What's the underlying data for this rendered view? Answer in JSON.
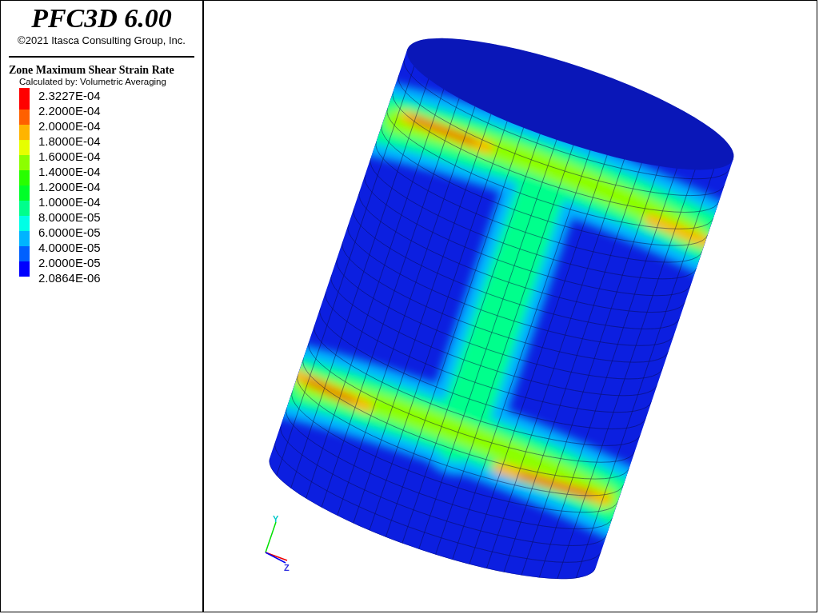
{
  "title": "PFC3D 6.00",
  "copyright": "©2021 Itasca Consulting Group, Inc.",
  "legend": {
    "title": "Zone Maximum Shear Strain Rate",
    "subtitle": "Calculated by: Volumetric Averaging",
    "bands": [
      {
        "color": "#ff0000"
      },
      {
        "color": "#ff6000"
      },
      {
        "color": "#ffb400"
      },
      {
        "color": "#e6ff00"
      },
      {
        "color": "#8cff00"
      },
      {
        "color": "#28ff00"
      },
      {
        "color": "#00ff28"
      },
      {
        "color": "#00ff8c"
      },
      {
        "color": "#00ffe6"
      },
      {
        "color": "#00b4ff"
      },
      {
        "color": "#0060ff"
      },
      {
        "color": "#0000ff"
      }
    ],
    "labels": [
      "2.3227E-04",
      "2.2000E-04",
      "2.0000E-04",
      "1.8000E-04",
      "1.6000E-04",
      "1.4000E-04",
      "1.2000E-04",
      "1.0000E-04",
      "8.0000E-05",
      "6.0000E-05",
      "4.0000E-05",
      "2.0000E-05",
      "2.0864E-06"
    ]
  },
  "axes": {
    "y_label": "Y",
    "z_label": "Z"
  }
}
